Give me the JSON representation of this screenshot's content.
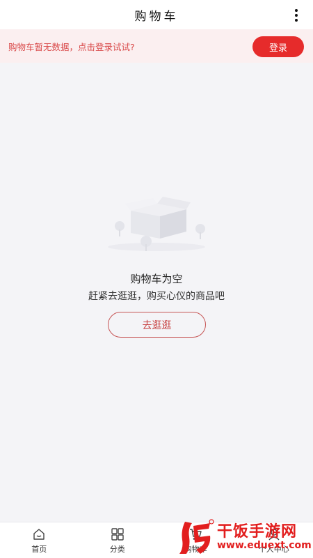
{
  "header": {
    "title": "购物车",
    "menu_icon": "more-vertical-icon"
  },
  "banner": {
    "message": "购物车暂无数据，点击登录试试?",
    "login_label": "登录"
  },
  "empty_state": {
    "illustration_icon": "empty-box-icon",
    "title": "购物车为空",
    "subtitle": "赶紧去逛逛，购买心仪的商品吧",
    "action_label": "去逛逛"
  },
  "tabbar": {
    "items": [
      {
        "label": "首页",
        "icon": "home-icon"
      },
      {
        "label": "分类",
        "icon": "grid-icon"
      },
      {
        "label": "购物车",
        "icon": "cart-icon"
      },
      {
        "label": "个人中心",
        "icon": "user-icon"
      }
    ]
  },
  "watermark": {
    "title": "干饭手游网",
    "url": "www.eduext.com",
    "logo_icon": "fan-logo-icon"
  },
  "colors": {
    "accent": "#e62b2b",
    "banner_bg": "#fbeff0",
    "page_bg": "#f4f4f7"
  }
}
